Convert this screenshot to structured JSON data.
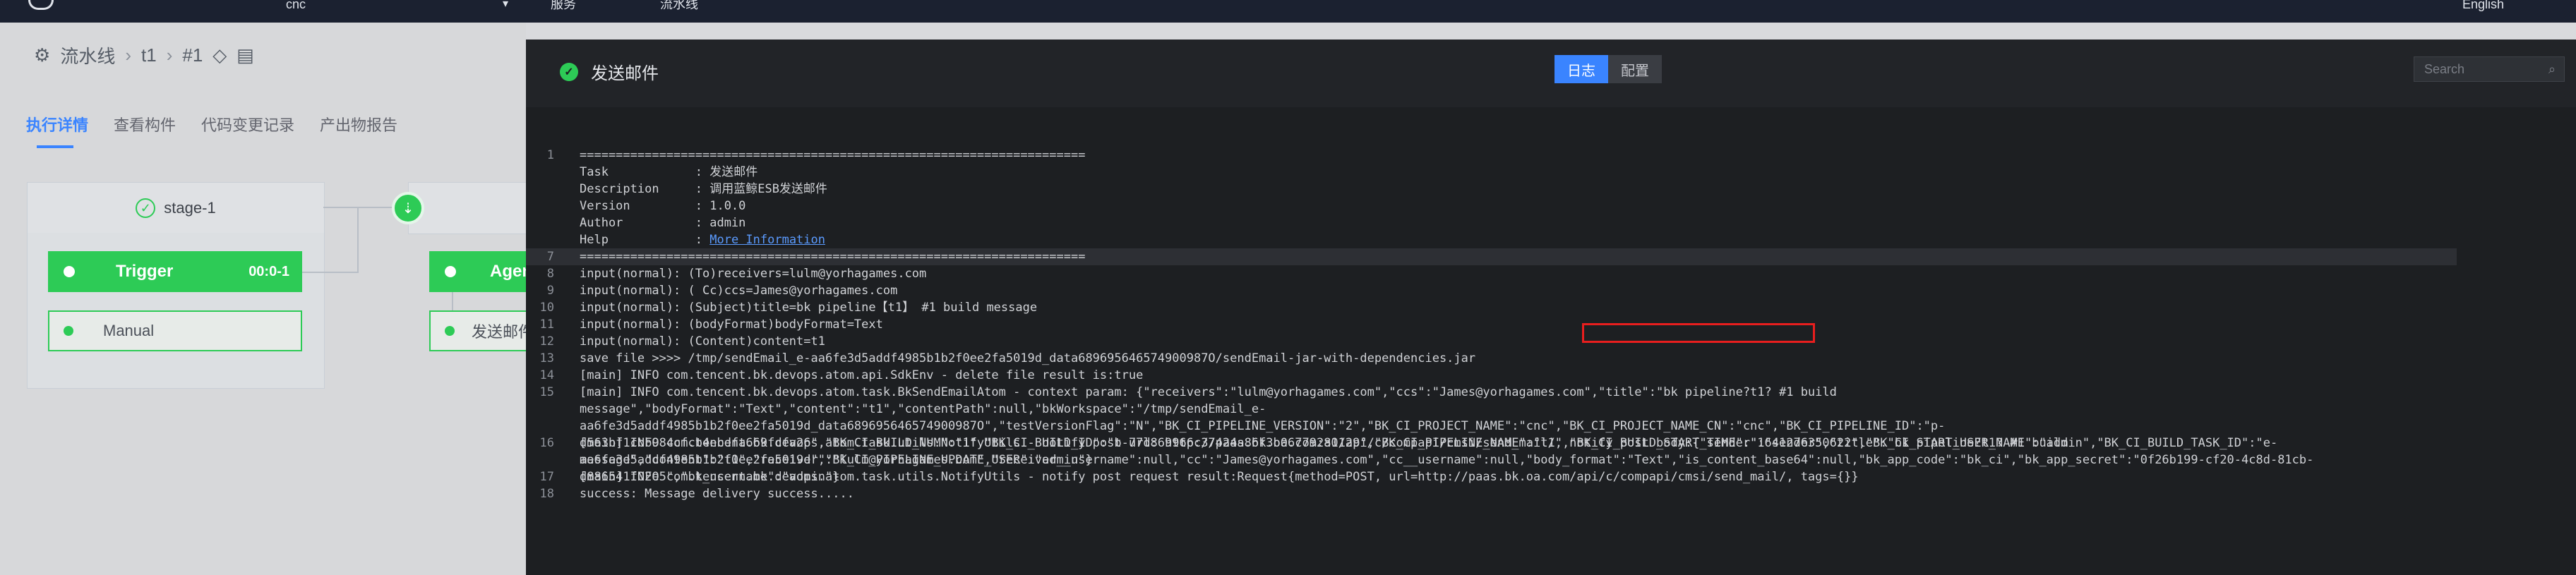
{
  "topbar": {
    "project": "cnc",
    "service": "服务",
    "pipeline": "流水线",
    "language": "English"
  },
  "breadcrumb": {
    "root": "流水线",
    "pipeline": "t1",
    "build": "#1"
  },
  "detail_tabs": [
    "执行详情",
    "查看构件",
    "代码变更记录",
    "产出物报告"
  ],
  "pipeline": {
    "stage1": "stage-1",
    "trigger": "Trigger",
    "trigger_time": "00:0-1",
    "manual": "Manual",
    "agent": "Agent",
    "sendmail": "发送邮件"
  },
  "panel": {
    "title": "发送邮件",
    "tab_log": "日志",
    "tab_config": "配置",
    "search_placeholder": "Search"
  },
  "log_lines": [
    {
      "n": "1",
      "t": "======================================================================"
    },
    {
      "n": "",
      "t": "Task            : 发送邮件"
    },
    {
      "n": "",
      "t": "Description     : 调用蓝鲸ESB发送邮件"
    },
    {
      "n": "",
      "t": "Version         : 1.0.0"
    },
    {
      "n": "",
      "t": "Author          : admin"
    },
    {
      "n": "",
      "t": "Help            : "
    },
    {
      "n": "7",
      "t": "======================================================================"
    },
    {
      "n": "8",
      "t": "input(normal): (To)receivers=lulm@yorhagames.com"
    },
    {
      "n": "9",
      "t": "input(normal): ( Cc)ccs=James@yorhagames.com"
    },
    {
      "n": "10",
      "t": "input(normal): (Subject)title=bk pipeline【t1】 #1 build message"
    },
    {
      "n": "11",
      "t": "input(normal): (bodyFormat)bodyFormat=Text"
    },
    {
      "n": "12",
      "t": "input(normal): (Content)content=t1"
    },
    {
      "n": "13",
      "t": "save file >>>> /tmp/sendEmail_e-aa6fe3d5addf4985b1b2f0ee2fa5019d_data689695646574900987O/sendEmail-jar-with-dependencies.jar"
    },
    {
      "n": "14",
      "t": "[main] INFO com.tencent.bk.devops.atom.api.SdkEnv - delete file result is:true"
    },
    {
      "n": "15",
      "t": "[main] INFO com.tencent.bk.devops.atom.task.BkSendEmailAtom - context param: {\"receivers\":\"lulm@yorhagames.com\",\"ccs\":\"James@yorhagames.com\",\"title\":\"bk pipeline?t1? #1 build message\",\"bodyFormat\":\"Text\",\"content\":\"t1\",\"contentPath\":null,\"bkWorkspace\":\"/tmp/sendEmail_e-aa6fe3d5addf4985b1b2f0ee2fa5019d_data689695646574900987O\",\"testVersionFlag\":\"N\",\"BK_CI_PIPELINE_VERSION\":\"2\",\"BK_CI_PROJECT_NAME\":\"cnc\",\"BK_CI_PROJECT_NAME_CN\":\"cnc\",\"BK_CI_PIPELINE_ID\":\"p-d563bf1cbb984cfcb4ebdfa669fcfa26\",\"BK_CI_BUILD_NUM\":\"1\",\"BK_CI_BUILD_ID\":\"b-77d869966c37424a86f3b067792a1129\",\"BK_CI_PIPELINE_NAME\":\"t1\",\"BK_CI_BUILD_START_TIME\":\"1641276350622\",\"BK_CI_START_USER_NAME\":\"admin\",\"BK_CI_BUILD_TASK_ID\":\"e-aa6fe3d5addf4985b1b2f0ee2fa5019d\",\"BK_CI_PIPELINE_UPDATE_USER\":\"admin\"}"
    },
    {
      "n": "16",
      "t": "[main] INFO com.tencent.bk.devops.atom.task.utils.NotifyUtils - notify post url: http://paas.bk.oa.com:80/api/c/compapi/cmsi/send_mail/, notify post body:{\"sender\":\"sender\",\"title\":\"bk pipeline?t1? #1 build message\",\"content\":\"t1\",\"receiver\":\"lulm@yorhagames.com\",\"receiver__username\":null,\"cc\":\"James@yorhagames.com\",\"cc__username\":null,\"body_format\":\"Text\",\"is_content_base64\":null,\"bk_app_code\":\"bk_ci\",\"bk_app_secret\":\"0f26b199-cf20-4c8d-81cb-d886541f02e5\",\"bk_username\":\"admin\"}"
    },
    {
      "n": "17",
      "t": "[main] INFO com.tencent.bk.devops.atom.task.utils.NotifyUtils - notify post request result:Request{method=POST, url=http://paas.bk.oa.com/api/c/compapi/cmsi/send_mail/, tags={}}"
    },
    {
      "n": "18",
      "t": "success: Message delivery success....."
    }
  ],
  "help_link": "More Information",
  "colors": {
    "success": "#2dcb56",
    "accent": "#3a84ff",
    "highlight_box": "#e81e1e",
    "panel_bg": "#1d1f22"
  }
}
